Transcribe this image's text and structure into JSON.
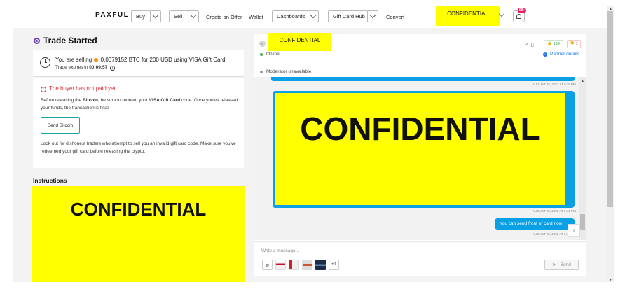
{
  "nav": {
    "logo": "PAXFUL",
    "buy": "Buy",
    "sell": "Sell",
    "create_offer": "Create an Offer",
    "wallet": "Wallet",
    "dashboards": "Dashboards",
    "gift_card_hub": "Gift Card Hub",
    "convert": "Convert",
    "confidential": "CONFIDENTIAL",
    "notif_badge": "99+"
  },
  "trade": {
    "title": "Trade Started",
    "selling_prefix": "You are selling",
    "amount_btc": "0.0079152 BTC",
    "for_text": "for 200 USD using VISA Gift Card",
    "expires_label": "Trade expires in",
    "expires_time": "00:09:57",
    "warning": "The buyer has not paid yet.",
    "para1_a": "Before releasing the",
    "para1_bitcoin": "Bitcoin",
    "para1_b": ", be sure to redeem your",
    "para1_card": "VISA Gift Card",
    "para1_c": "code. Once you've released your funds, the transaction is final.",
    "send_button": "Send Bitcoin",
    "para2": "Look out for dishonest traders who attempt to sell you an invalid gift card code. Make sure you've redeemed your gift card before releasing the crypto.",
    "instructions": "Instructions",
    "confidential": "CONFIDENTIAL"
  },
  "chat": {
    "header_confidential": "CONFIDENTIAL",
    "online": "Online",
    "moderator": "Moderator unavailable",
    "likes": "139",
    "dislikes": "1",
    "partner_details": "Partner details",
    "ts1": "AUGUST 25, 2022 AT 6:39 PM",
    "confidential": "CONFIDENTIAL",
    "ts2": "AUGUST 25, 2022 AT 6:41 PM",
    "last_msg": "You can send front of card now",
    "ts3": "AUGUST 25, 2022 AT 6:4",
    "input_placeholder": "Write a message...",
    "more": "+1",
    "send": "Send"
  },
  "colors": {
    "accent": "#0aa0e3",
    "confidential": "#ffff00",
    "warning": "#d9363e",
    "success": "#2a9d4a"
  }
}
